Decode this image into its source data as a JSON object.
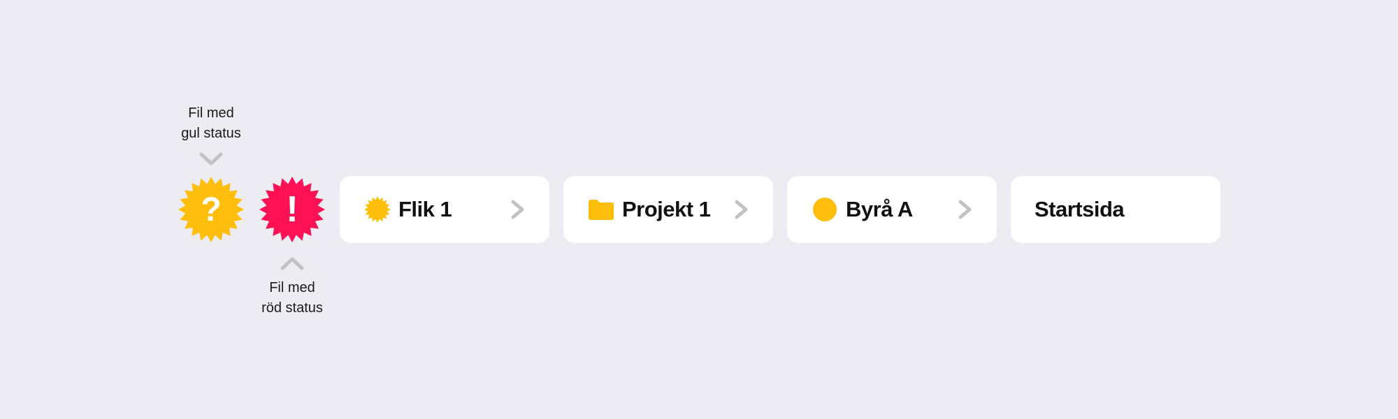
{
  "callouts": {
    "yellow": {
      "line1": "Fil med",
      "line2": "gul status"
    },
    "red": {
      "line1": "Fil med",
      "line2": "röd status"
    }
  },
  "badges": {
    "yellow": {
      "icon": "question-badge-icon",
      "glyph": "?",
      "color": "#ffbe0b"
    },
    "red": {
      "icon": "exclamation-badge-icon",
      "glyph": "!",
      "color": "#ff1155"
    }
  },
  "breadcrumb": {
    "items": [
      {
        "label": "Flik 1",
        "icon": "sun-badge-icon",
        "chevron": true
      },
      {
        "label": "Projekt 1",
        "icon": "folder-icon",
        "chevron": true
      },
      {
        "label": "Byrå A",
        "icon": "circle-icon",
        "chevron": true
      },
      {
        "label": "Startsida",
        "icon": "",
        "chevron": false
      }
    ]
  },
  "colors": {
    "background": "#edecf2",
    "card": "#ffffff",
    "accent_yellow": "#ffbe0b",
    "accent_red": "#ff1155",
    "chevron_gray": "#c2c2c6"
  }
}
